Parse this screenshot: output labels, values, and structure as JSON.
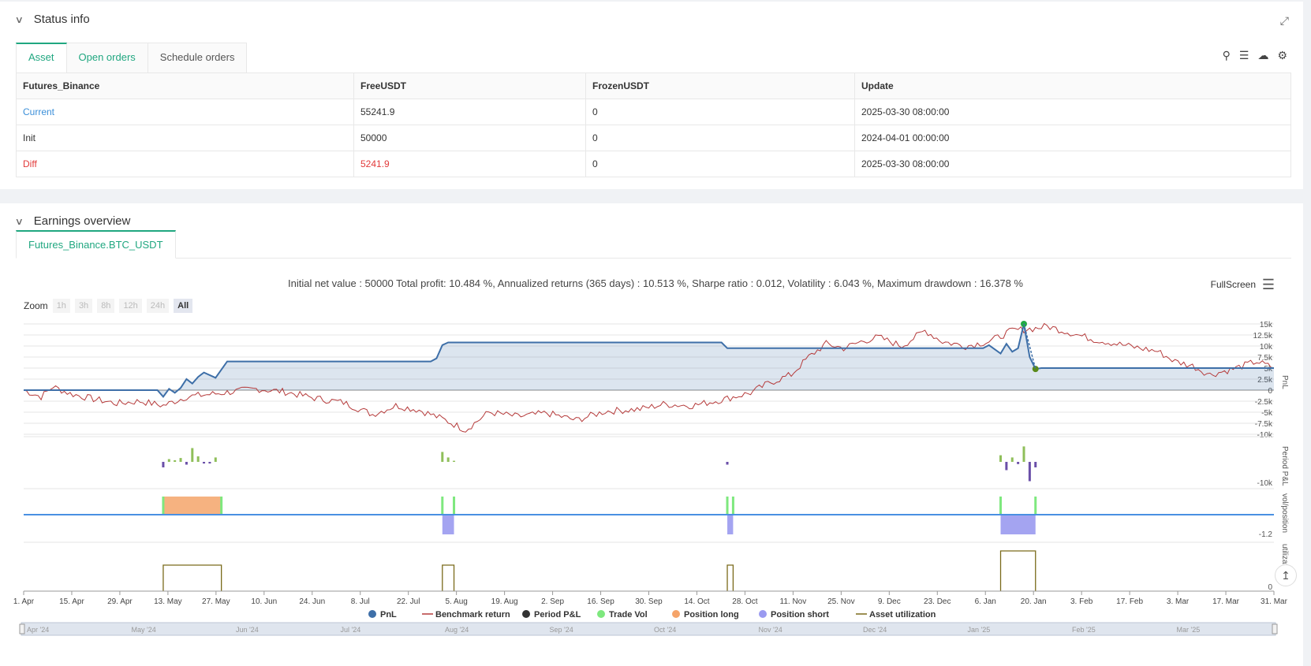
{
  "status": {
    "title": "Status info",
    "tabs": [
      "Asset",
      "Open orders",
      "Schedule orders"
    ],
    "table": {
      "headers": [
        "Futures_Binance",
        "FreeUSDT",
        "FrozenUSDT",
        "Update"
      ],
      "rows": [
        [
          "Current",
          "55241.9",
          "0",
          "2025-03-30 08:00:00"
        ],
        [
          "Init",
          "50000",
          "0",
          "2024-04-01 00:00:00"
        ],
        [
          "Diff",
          "5241.9",
          "0",
          "2025-03-30 08:00:00"
        ]
      ]
    }
  },
  "earnings": {
    "title": "Earnings overview",
    "tab": "Futures_Binance.BTC_USDT",
    "summary": "Initial net value : 50000 Total profit: 10.484 %, Annualized returns (365 days) : 10.513 %, Sharpe ratio : 0.012, Volatility : 6.043 %, Maximum drawdown : 16.378 %",
    "fullscreen": "FullScreen",
    "zoom_label": "Zoom",
    "zoom_buttons": [
      "1h",
      "3h",
      "8h",
      "12h",
      "24h",
      "All"
    ],
    "zoom_active": "All"
  },
  "chart_data": {
    "type": "line",
    "x_ticks": [
      "1. Apr",
      "15. Apr",
      "29. Apr",
      "13. May",
      "27. May",
      "10. Jun",
      "24. Jun",
      "8. Jul",
      "22. Jul",
      "5. Aug",
      "19. Aug",
      "2. Sep",
      "16. Sep",
      "30. Sep",
      "14. Oct",
      "28. Oct",
      "11. Nov",
      "25. Nov",
      "9. Dec",
      "23. Dec",
      "6. Jan",
      "20. Jan",
      "3. Feb",
      "17. Feb",
      "3. Mar",
      "17. Mar",
      "31. Mar"
    ],
    "navigator_ticks": [
      "Apr '24",
      "May '24",
      "Jun '24",
      "Jul '24",
      "Aug '24",
      "Sep '24",
      "Oct '24",
      "Nov '24",
      "Dec '24",
      "Jan '25",
      "Feb '25",
      "Mar '25"
    ],
    "pnl_panel": {
      "ylabel": "PnL",
      "y_ticks": [
        "15k",
        "12.5k",
        "10k",
        "7.5k",
        "5k",
        "2.5k",
        "0",
        "-2.5k",
        "-5k",
        "-7.5k",
        "-10k"
      ],
      "ylim": [
        -10000,
        15000
      ],
      "pnl": [
        [
          0,
          0
        ],
        [
          23,
          0
        ],
        [
          24,
          -1500
        ],
        [
          25,
          300
        ],
        [
          26,
          -600
        ],
        [
          27,
          500
        ],
        [
          28,
          2500
        ],
        [
          29,
          1500
        ],
        [
          30,
          3000
        ],
        [
          31,
          4000
        ],
        [
          33,
          2800
        ],
        [
          35,
          6500
        ],
        [
          70,
          6500
        ],
        [
          71,
          7200
        ],
        [
          72,
          10200
        ],
        [
          73,
          10800
        ],
        [
          120,
          10800
        ],
        [
          121,
          9500
        ],
        [
          165,
          9500
        ],
        [
          166,
          10200
        ],
        [
          168,
          8300
        ],
        [
          169,
          10500
        ],
        [
          170,
          8700
        ],
        [
          171,
          9500
        ],
        [
          172,
          15000
        ],
        [
          173,
          7500
        ],
        [
          174,
          4800
        ],
        [
          175,
          5000
        ],
        [
          215,
          5000
        ]
      ],
      "benchmark_anchors": [
        [
          0,
          0
        ],
        [
          3,
          -1500
        ],
        [
          5,
          800
        ],
        [
          8,
          -800
        ],
        [
          12,
          -2000
        ],
        [
          16,
          -3000
        ],
        [
          20,
          -2500
        ],
        [
          24,
          -3500
        ],
        [
          28,
          -1500
        ],
        [
          33,
          -800
        ],
        [
          40,
          300
        ],
        [
          45,
          -400
        ],
        [
          50,
          -1800
        ],
        [
          55,
          -2800
        ],
        [
          60,
          -5500
        ],
        [
          64,
          -3500
        ],
        [
          68,
          -4500
        ],
        [
          72,
          -6500
        ],
        [
          76,
          -9000
        ],
        [
          80,
          -5000
        ],
        [
          85,
          -6000
        ],
        [
          90,
          -5200
        ],
        [
          95,
          -6800
        ],
        [
          100,
          -4800
        ],
        [
          106,
          -4300
        ],
        [
          110,
          -3200
        ],
        [
          115,
          -3500
        ],
        [
          120,
          -2200
        ],
        [
          125,
          -600
        ],
        [
          128,
          1500
        ],
        [
          132,
          3500
        ],
        [
          135,
          7500
        ],
        [
          138,
          10500
        ],
        [
          141,
          9500
        ],
        [
          144,
          11000
        ],
        [
          147,
          12000
        ],
        [
          151,
          10000
        ],
        [
          155,
          13500
        ],
        [
          158,
          11000
        ],
        [
          162,
          10000
        ],
        [
          166,
          11000
        ],
        [
          170,
          13500
        ],
        [
          174,
          14000
        ],
        [
          176,
          14500
        ],
        [
          180,
          13000
        ],
        [
          184,
          11500
        ],
        [
          188,
          10500
        ],
        [
          192,
          9500
        ],
        [
          195,
          8800
        ],
        [
          198,
          6500
        ],
        [
          201,
          5500
        ],
        [
          204,
          3500
        ],
        [
          208,
          4800
        ],
        [
          212,
          6500
        ],
        [
          215,
          5000
        ]
      ],
      "buy_marker": [
        172,
        15000
      ],
      "sell_marker": [
        174,
        4800
      ]
    },
    "period_panel": {
      "ylabel": "Period P&L",
      "y_ticks": [
        "-10k"
      ],
      "bars": [
        [
          24,
          -1000
        ],
        [
          25,
          500
        ],
        [
          26,
          300
        ],
        [
          27,
          700
        ],
        [
          28,
          -500
        ],
        [
          29,
          2500
        ],
        [
          30,
          1000
        ],
        [
          31,
          -300
        ],
        [
          32,
          -300
        ],
        [
          33,
          800
        ],
        [
          72,
          1800
        ],
        [
          73,
          800
        ],
        [
          74,
          200
        ],
        [
          121,
          -500
        ],
        [
          168,
          1200
        ],
        [
          169,
          -1500
        ],
        [
          170,
          800
        ],
        [
          171,
          -400
        ],
        [
          172,
          2800
        ],
        [
          173,
          -3500
        ],
        [
          174,
          -1000
        ]
      ]
    },
    "position_panel": {
      "ylabel": "vol/position",
      "y_ticks": [
        "-1.2"
      ],
      "long_blocks": [
        [
          24,
          34
        ]
      ],
      "short_blocks": [
        [
          72,
          74
        ],
        [
          121,
          122
        ],
        [
          168,
          174
        ]
      ],
      "trade_vol": [
        24,
        34,
        72,
        74,
        121,
        122,
        168,
        174
      ]
    },
    "util_panel": {
      "ylabel": "utilizat",
      "y_ticks": [
        "0"
      ],
      "blocks": [
        [
          24,
          34,
          0.55
        ],
        [
          72,
          74,
          0.55
        ],
        [
          121,
          122,
          0.55
        ],
        [
          168,
          174,
          0.85
        ]
      ]
    },
    "legend": [
      {
        "name": "PnL",
        "color": "#3e6fa8",
        "symbol": "dot"
      },
      {
        "name": "Benchmark return",
        "color": "#b53a3a",
        "symbol": "line"
      },
      {
        "name": "Period P&L",
        "color": "#333333",
        "symbol": "dot"
      },
      {
        "name": "Trade Vol",
        "color": "#7ee87e",
        "symbol": "dot"
      },
      {
        "name": "Position long",
        "color": "#f5a46a",
        "symbol": "dot"
      },
      {
        "name": "Position short",
        "color": "#9a9af0",
        "symbol": "dot"
      },
      {
        "name": "Asset utilization",
        "color": "#7a6a1a",
        "symbol": "line"
      }
    ]
  }
}
